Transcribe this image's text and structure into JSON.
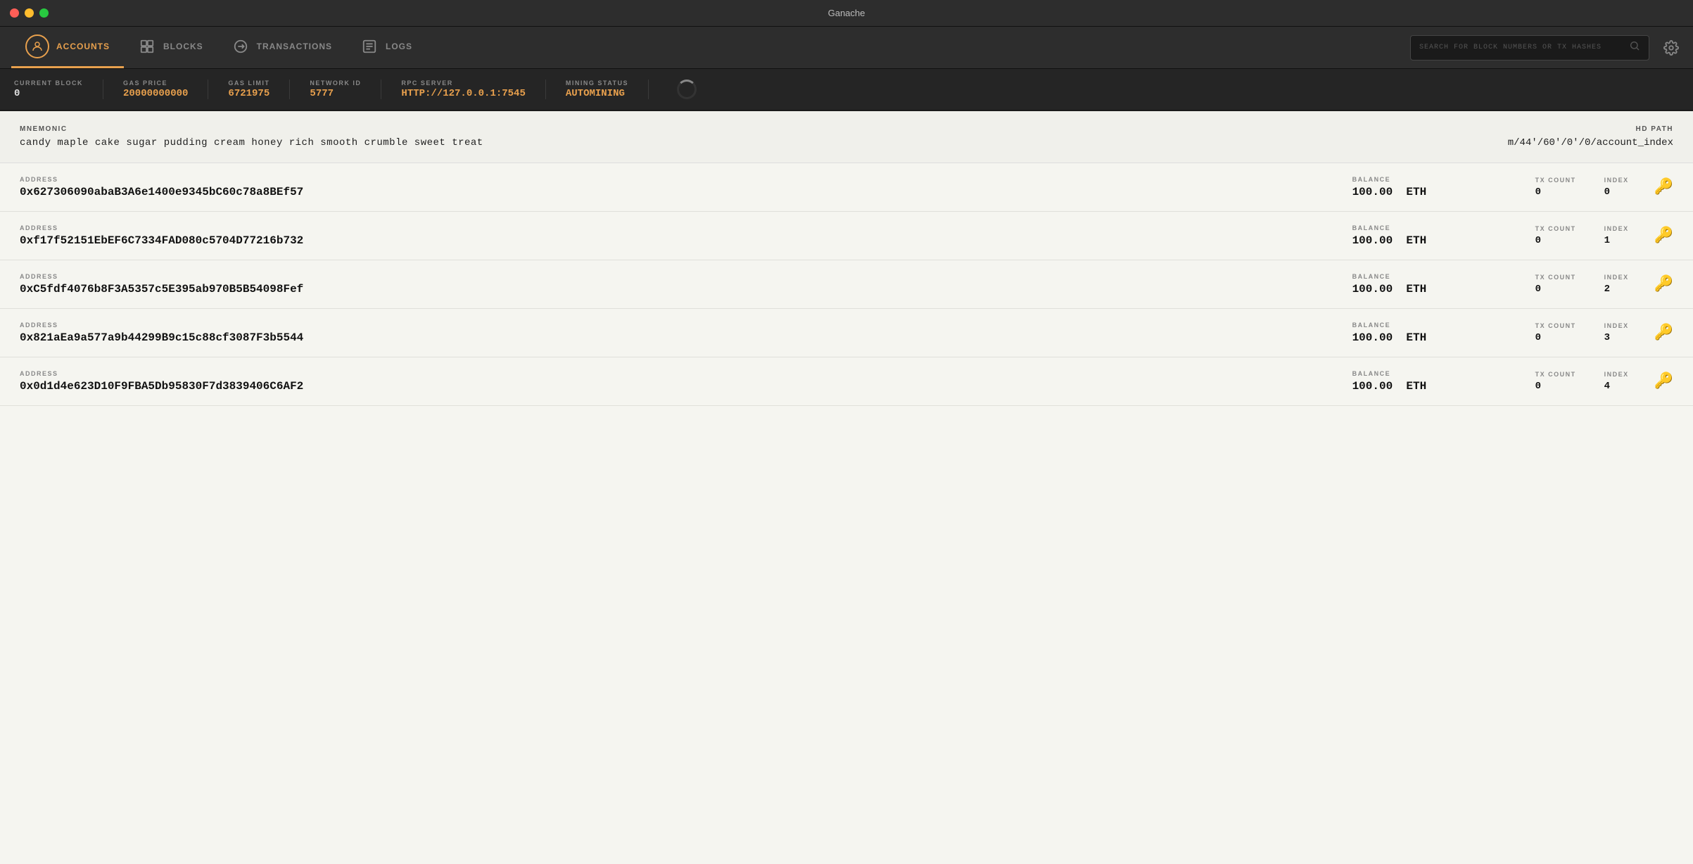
{
  "titleBar": {
    "title": "Ganache"
  },
  "nav": {
    "items": [
      {
        "id": "accounts",
        "label": "ACCOUNTS",
        "icon": "person-icon",
        "active": true
      },
      {
        "id": "blocks",
        "label": "BLOCKS",
        "icon": "blocks-icon",
        "active": false
      },
      {
        "id": "transactions",
        "label": "TRANSACTIONS",
        "icon": "transactions-icon",
        "active": false
      },
      {
        "id": "logs",
        "label": "LOGS",
        "icon": "logs-icon",
        "active": false
      }
    ],
    "search": {
      "placeholder": "SEARCH FOR BLOCK NUMBERS OR TX HASHES"
    }
  },
  "statusBar": {
    "items": [
      {
        "id": "current-block",
        "label": "CURRENT BLOCK",
        "value": "0",
        "orange": false
      },
      {
        "id": "gas-price",
        "label": "GAS PRICE",
        "value": "20000000000",
        "orange": true
      },
      {
        "id": "gas-limit",
        "label": "GAS LIMIT",
        "value": "6721975",
        "orange": true
      },
      {
        "id": "network-id",
        "label": "NETWORK ID",
        "value": "5777",
        "orange": true
      },
      {
        "id": "rpc-server",
        "label": "RPC SERVER",
        "value": "HTTP://127.0.0.1:7545",
        "orange": true
      },
      {
        "id": "mining-status",
        "label": "MINING STATUS",
        "value": "AUTOMINING",
        "orange": true
      }
    ]
  },
  "mnemonic": {
    "label": "MNEMONIC",
    "value": "candy maple cake sugar pudding cream honey rich smooth crumble sweet treat",
    "hdPath": {
      "label": "HD PATH",
      "value": "m/44'/60'/0'/0/account_index"
    }
  },
  "accounts": [
    {
      "address": "0x627306090abaB3A6e1400e9345bC60c78a8BEf57",
      "balance": "100.00",
      "currency": "ETH",
      "txCount": "0",
      "index": "0"
    },
    {
      "address": "0xf17f52151EbEF6C7334FAD080c5704D77216b732",
      "balance": "100.00",
      "currency": "ETH",
      "txCount": "0",
      "index": "1"
    },
    {
      "address": "0xC5fdf4076b8F3A5357c5E395ab970B5B54098Fef",
      "balance": "100.00",
      "currency": "ETH",
      "txCount": "0",
      "index": "2"
    },
    {
      "address": "0x821aEa9a577a9b44299B9c15c88cf3087F3b5544",
      "balance": "100.00",
      "currency": "ETH",
      "txCount": "0",
      "index": "3"
    },
    {
      "address": "0x0d1d4e623D10F9FBA5Db95830F7d3839406C6AF2",
      "balance": "100.00",
      "currency": "ETH",
      "txCount": "0",
      "index": "4"
    }
  ],
  "labels": {
    "address": "ADDRESS",
    "balance": "BALANCE",
    "txCount": "TX COUNT",
    "index": "INDEX"
  }
}
